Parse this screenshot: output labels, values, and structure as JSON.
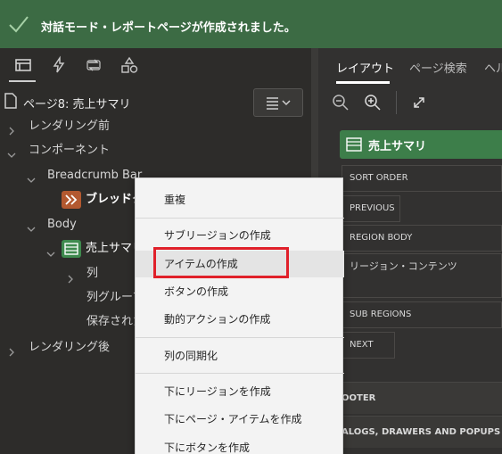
{
  "notification": {
    "message": "対話モード・レポートページが作成されました。"
  },
  "left_toolbar": {
    "icons": [
      "rendering-tree-icon",
      "lightning-icon",
      "processing-icon",
      "shared-components-icon"
    ]
  },
  "tree": {
    "page_label": "ページ8: 売上サマリ",
    "nodes": [
      {
        "label": "レンダリング前"
      },
      {
        "label": "コンポーネント"
      },
      {
        "label": "Breadcrumb Bar"
      },
      {
        "label": "ブレッドク"
      },
      {
        "label": "Body"
      },
      {
        "label": "売上サマリ"
      },
      {
        "label": "列"
      },
      {
        "label": "列グループ"
      },
      {
        "label": "保存された"
      },
      {
        "label": "レンダリング後"
      }
    ]
  },
  "right_pane": {
    "tabs": [
      {
        "label": "レイアウト",
        "active": true
      },
      {
        "label": "ページ検索",
        "active": false
      },
      {
        "label": "ヘル",
        "active": false
      }
    ],
    "region_title": "売上サマリ",
    "positions": [
      "SORT ORDER",
      "PREVIOUS",
      "REGION BODY",
      "リージョン・コンテンツ",
      "SUB REGIONS",
      "NEXT",
      "OOTER",
      "ALOGS, DRAWERS AND POPUPS"
    ]
  },
  "context_menu": {
    "items": [
      {
        "label": "重複"
      },
      {
        "label": "サブリージョンの作成"
      },
      {
        "label": "アイテムの作成",
        "highlighted": true
      },
      {
        "label": "ボタンの作成"
      },
      {
        "label": "動的アクションの作成"
      },
      {
        "label": "列の同期化"
      },
      {
        "label": "下にリージョンを作成"
      },
      {
        "label": "下にページ・アイテムを作成"
      },
      {
        "label": "下にボタンを作成"
      }
    ]
  },
  "colors": {
    "success_bar": "#3c6b44",
    "highlight_border": "#e0202a",
    "region_green": "#3d7e4a"
  }
}
